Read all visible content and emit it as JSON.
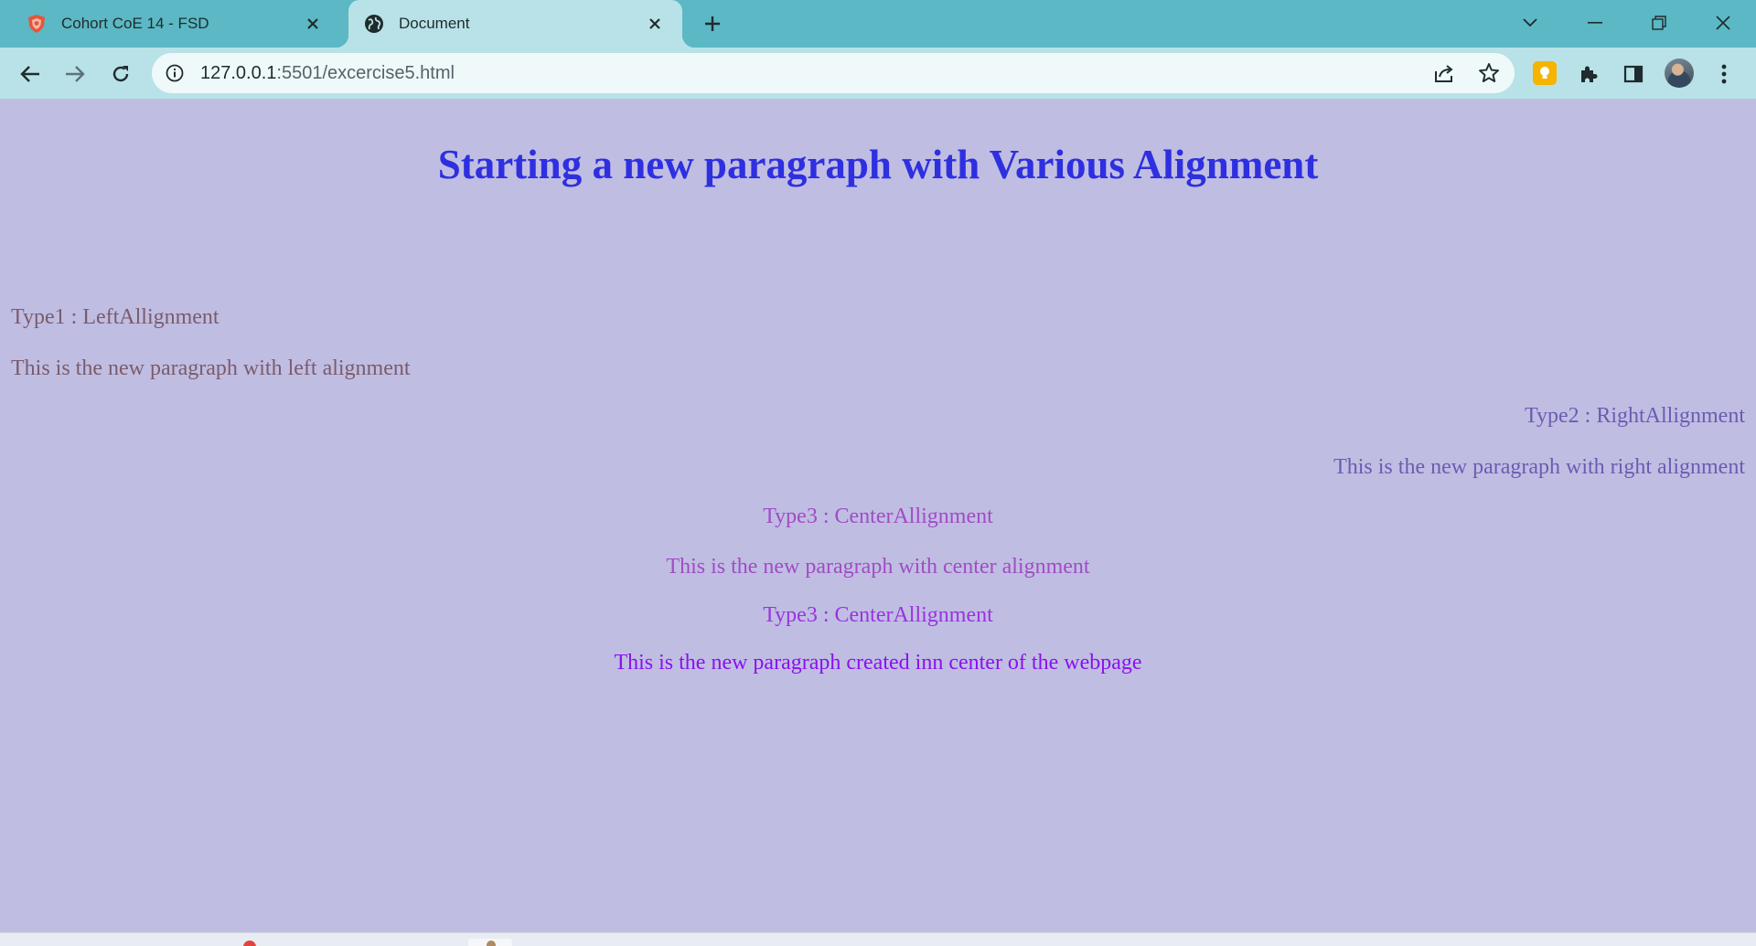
{
  "browser": {
    "tabs": [
      {
        "title": "Cohort CoE 14 - FSD",
        "favicon": "shield-favicon-icon",
        "active": false
      },
      {
        "title": "Document",
        "favicon": "globe-icon",
        "active": true
      }
    ],
    "address": {
      "host": "127.0.0.1",
      "path": ":5501/excercise5.html"
    }
  },
  "page": {
    "heading": "Starting a new paragraph with Various Alignment",
    "left_type": "Type1 : LeftAllignment",
    "left_paragraph": "This is the new paragraph with left alignment",
    "right_type": "Type2 : RightAllignment",
    "right_paragraph": "This is the new paragraph with right alignment",
    "center_type_1": "Type3 : CenterAllignment",
    "center_paragraph_1": "This is the new paragraph with center alignment",
    "center_type_2": "Type3 : CenterAllignment",
    "center_paragraph_2": "This is the new paragraph created inn center of the webpage"
  },
  "colors": {
    "page_background": "#c0bde3",
    "heading": "#2e2fe0",
    "left_text": "#7a5c6a",
    "right_text": "#6a5cb0",
    "center_text": "#a04cc4",
    "center_text_2": "#9a33e0",
    "center_paragraph_2": "#8a10f0",
    "tab_strip": "#5bb8c4",
    "toolbar": "#b8e2e7"
  }
}
